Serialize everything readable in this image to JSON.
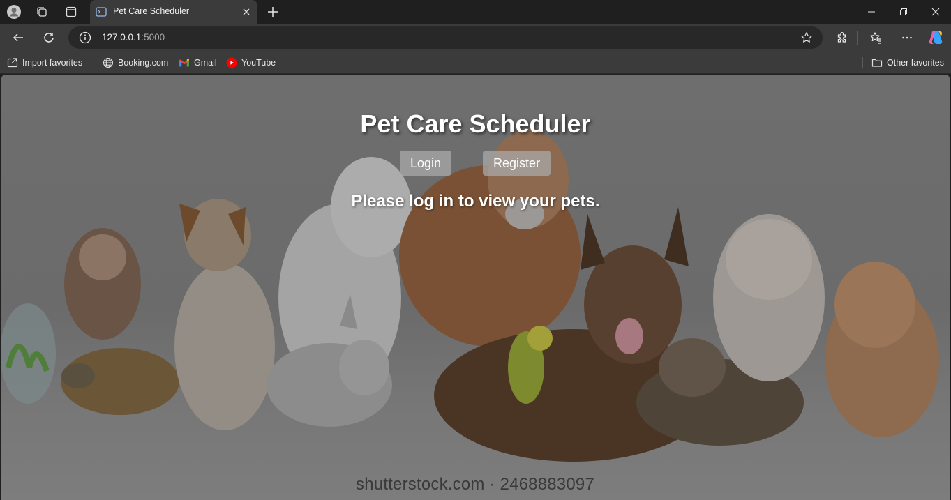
{
  "browser": {
    "tab": {
      "title": "Pet Care Scheduler"
    },
    "address": {
      "host": "127.0.0.1",
      "port": ":5000"
    },
    "favorites": [
      {
        "label": "Import favorites",
        "icon": "import-icon"
      },
      {
        "label": "Booking.com",
        "icon": "globe-icon"
      },
      {
        "label": "Gmail",
        "icon": "gmail-icon"
      },
      {
        "label": "YouTube",
        "icon": "youtube-icon"
      }
    ],
    "other_favorites": "Other favorites"
  },
  "page": {
    "title": "Pet Care Scheduler",
    "login_label": "Login",
    "register_label": "Register",
    "message": "Please log in to view your pets.",
    "watermark": "shutterstock.com · 2468883097"
  }
}
